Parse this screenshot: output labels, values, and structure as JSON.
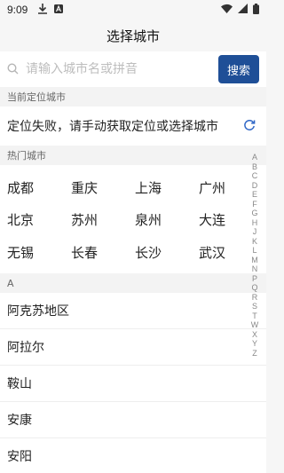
{
  "status_bar": {
    "time": "9:09",
    "icons_left": [
      "download-icon",
      "a-badge-icon"
    ],
    "icons_right": [
      "wifi-icon",
      "signal-icon",
      "battery-icon"
    ]
  },
  "header": {
    "title": "选择城市"
  },
  "search": {
    "placeholder": "请输入城市名或拼音",
    "button_label": "搜索",
    "accent_color": "#1f4f97"
  },
  "current_location": {
    "section_title": "当前定位城市",
    "message": "定位失败，请手动获取定位或选择城市",
    "refresh_icon": "refresh-icon"
  },
  "hot_cities": {
    "section_title": "热门城市",
    "cities": [
      "成都",
      "重庆",
      "上海",
      "广州",
      "北京",
      "苏州",
      "泉州",
      "大连",
      "无锡",
      "长春",
      "长沙",
      "武汉"
    ]
  },
  "city_group": {
    "letter": "A",
    "cities": [
      "阿克苏地区",
      "阿拉尔",
      "鞍山",
      "安康",
      "安阳"
    ]
  },
  "index_letters": [
    "A",
    "B",
    "C",
    "D",
    "E",
    "F",
    "G",
    "H",
    "J",
    "K",
    "L",
    "M",
    "N",
    "P",
    "Q",
    "R",
    "S",
    "T",
    "W",
    "X",
    "Y",
    "Z"
  ]
}
